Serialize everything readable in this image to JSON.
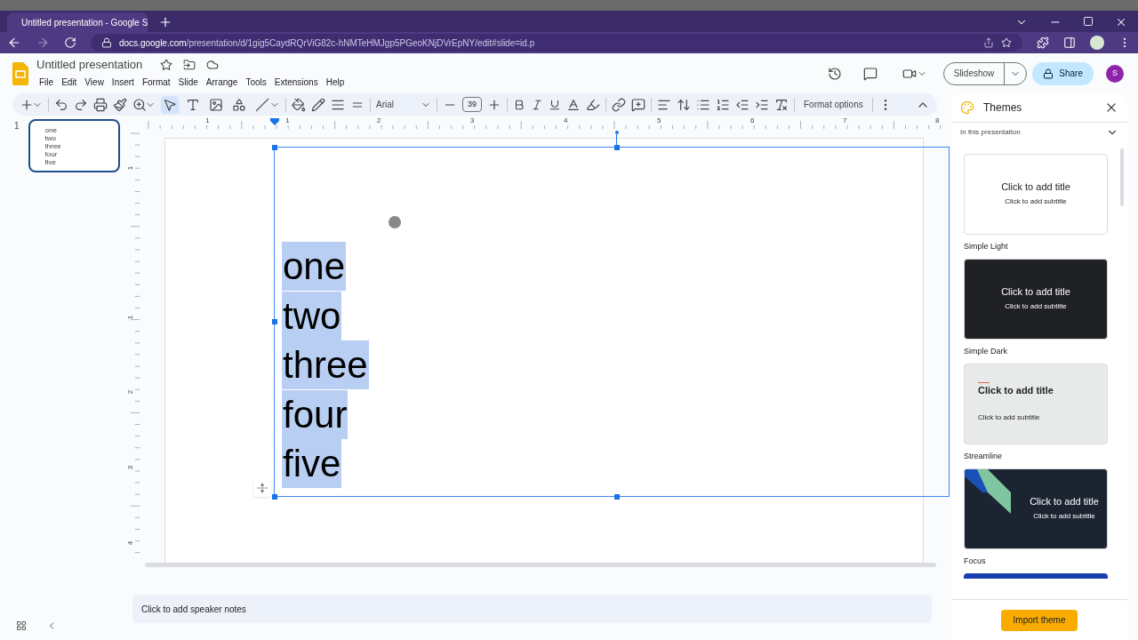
{
  "browser": {
    "tab_title": "Untitled presentation - Google S",
    "url_host": "docs.google.com",
    "url_path": "/presentation/d/1gig5CaydRQrViG82c-hNMTeHMJgp5PGeoKNjDVrEpNY/edit#slide=id.p"
  },
  "app": {
    "title": "Untitled presentation",
    "menu": [
      "File",
      "Edit",
      "View",
      "Insert",
      "Format",
      "Slide",
      "Arrange",
      "Tools",
      "Extensions",
      "Help"
    ],
    "slideshow": "Slideshow",
    "share": "Share",
    "avatar": "S"
  },
  "toolbar": {
    "tools": [
      {
        "kind": "select",
        "selected": true
      },
      {
        "kind": "textbox",
        "selected": false
      },
      {
        "kind": "image",
        "selected": false
      },
      {
        "kind": "shape",
        "selected": false
      },
      {
        "kind": "line",
        "selected": false
      }
    ],
    "font": "Arial",
    "font_size": "39",
    "format_options": "Format options"
  },
  "rulers": {
    "horizontal": [
      "1",
      "1",
      "2",
      "3",
      "4",
      "5",
      "6",
      "7",
      "8"
    ],
    "vertical": [
      "1",
      "1",
      "2",
      "3",
      "4"
    ]
  },
  "filmstrip": [
    {
      "number": "1",
      "selected": true,
      "lines": [
        "one",
        "two",
        "three",
        "four",
        "five"
      ]
    }
  ],
  "slide": {
    "text_selected": true,
    "lines": [
      "one",
      "two",
      "three",
      "four",
      "five"
    ]
  },
  "notes": {
    "placeholder": "Click to add speaker notes"
  },
  "themes": {
    "title": "Themes",
    "section": "In this presentation",
    "items": [
      {
        "kind": "light",
        "name": "Simple Light",
        "title": "Click to add title",
        "subtitle": "Click to add subtitle"
      },
      {
        "kind": "dark",
        "name": "Simple Dark",
        "title": "Click to add title",
        "subtitle": "Click to add subtitle"
      },
      {
        "kind": "streamline",
        "name": "Streamline",
        "title": "Click to add title",
        "subtitle": "Click to add subtitle"
      },
      {
        "kind": "focus",
        "name": "Focus",
        "title": "Click to add title",
        "subtitle": "Click to add subtitle"
      },
      {
        "kind": "partial"
      }
    ],
    "import": "Import theme"
  }
}
